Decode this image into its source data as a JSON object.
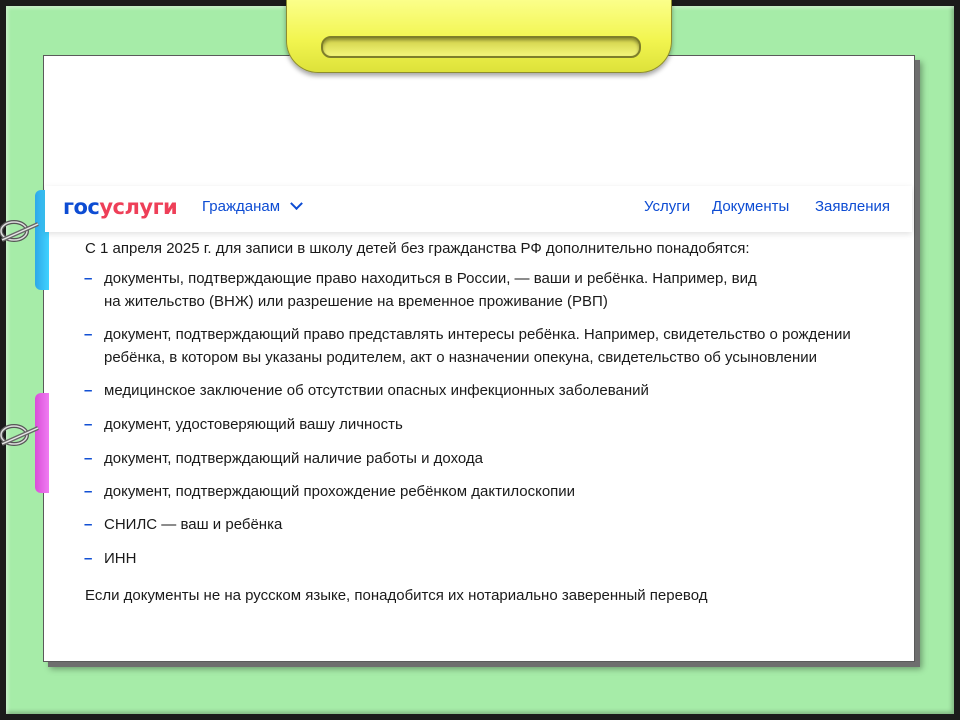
{
  "header": {
    "logo_part1": "гос",
    "logo_part2": "услуги",
    "nav_citizens": "Гражданам",
    "nav_services": "Услуги",
    "nav_documents": "Документы",
    "nav_applications": "Заявления"
  },
  "content": {
    "intro": "С 1 апреля 2025 г. для записи в школу детей без гражданства РФ дополнительно понадобятся:",
    "items": [
      {
        "line1": "документы, подтверждающие право находиться в России, — ваши и ребёнка. Например, вид",
        "line2": "на жительство (ВНЖ) или разрешение на временное проживание (РВП)"
      },
      {
        "line1": "документ, подтверждающий право представлять интересы ребёнка. Например, свидетельство о рождении",
        "line2": "ребёнка, в котором вы указаны родителем, акт о назначении опекуна, свидетельство об усыновлении"
      },
      {
        "line1": "медицинское заключение об отсутствии опасных инфекционных заболеваний"
      },
      {
        "line1": "документ, удостоверяющий вашу личность"
      },
      {
        "line1": "документ, подтверждающий наличие работы и дохода"
      },
      {
        "line1": "документ, подтверждающий прохождение ребёнком дактилоскопии"
      },
      {
        "line1": "СНИЛС — ваш и ребёнка"
      },
      {
        "line1": "ИНН"
      }
    ],
    "outro": "Если документы не на русском языке, понадобится их нотариально заверенный перевод"
  },
  "colors": {
    "frame_green": "#a6eca8",
    "clip_yellow": "#f2f550",
    "tab_blue": "#2ea8e8",
    "tab_pink": "#d94fd8",
    "gu_blue": "#0d4cd3",
    "gu_red": "#ee3f58"
  },
  "icons": [
    "chevron-down-icon",
    "ring-clip-icon"
  ]
}
